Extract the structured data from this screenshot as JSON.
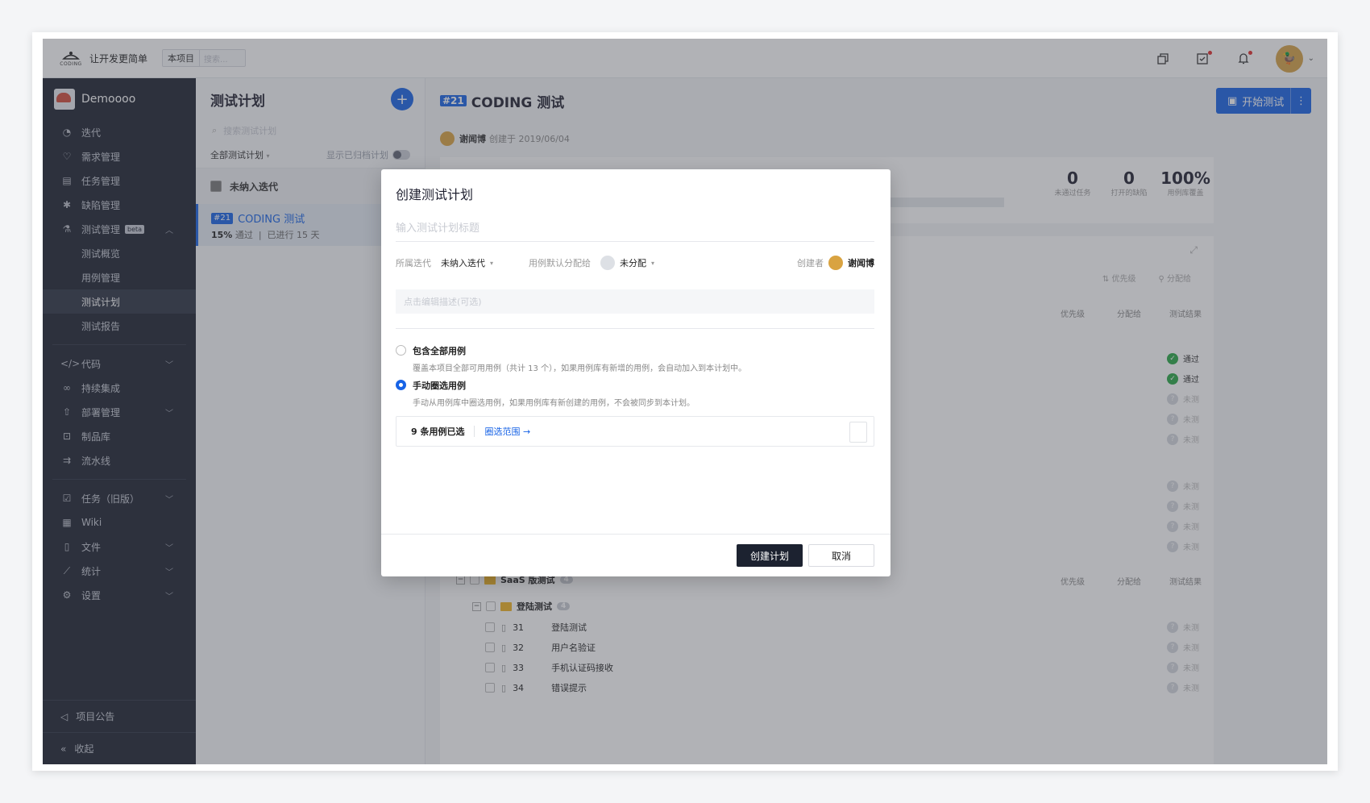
{
  "topbar": {
    "logo_text": "CODING",
    "slogan": "让开发更简单",
    "scope_tag": "本项目",
    "search_placeholder": "搜索..."
  },
  "sidebar": {
    "project_name": "Demoooo",
    "items": [
      {
        "label": "迭代",
        "icon": "iteration-icon"
      },
      {
        "label": "需求管理",
        "icon": "bulb-icon"
      },
      {
        "label": "任务管理",
        "icon": "task-icon"
      },
      {
        "label": "缺陷管理",
        "icon": "bug-icon"
      },
      {
        "label": "测试管理",
        "icon": "flask-icon",
        "badge": "beta"
      },
      {
        "label": "测试概览"
      },
      {
        "label": "用例管理"
      },
      {
        "label": "测试计划"
      },
      {
        "label": "测试报告"
      },
      {
        "label": "代码",
        "icon": "code-icon"
      },
      {
        "label": "持续集成",
        "icon": "infinity-icon"
      },
      {
        "label": "部署管理",
        "icon": "rocket-icon"
      },
      {
        "label": "制品库",
        "icon": "package-icon"
      },
      {
        "label": "流水线",
        "icon": "pipeline-icon"
      },
      {
        "label": "任务（旧版）",
        "icon": "checkbox-icon"
      },
      {
        "label": "Wiki",
        "icon": "doc-icon"
      },
      {
        "label": "文件",
        "icon": "file-icon"
      },
      {
        "label": "统计",
        "icon": "chart-icon"
      },
      {
        "label": "设置",
        "icon": "gear-icon"
      }
    ],
    "announcement": "项目公告",
    "collapse": "收起"
  },
  "plans": {
    "title": "测试计划",
    "search_placeholder": "搜索测试计划",
    "filter_label": "全部测试计划",
    "show_archived": "显示已归档计划",
    "group_label": "未纳入迭代",
    "item": {
      "id": "#21",
      "name": "CODING 测试",
      "pass_pct": "15%",
      "pass_label": "通过",
      "duration": "已进行 15 天"
    }
  },
  "main": {
    "id": "#21",
    "title": "CODING 测试",
    "start_button": "开始测试",
    "creator": "谢闻博",
    "created_text": "创建于 2019/06/04",
    "stats": [
      {
        "value": "0",
        "label": "未通过任务"
      },
      {
        "value": "0",
        "label": "打开的缺陷"
      },
      {
        "value": "100%",
        "label": "用例库覆盖"
      }
    ],
    "toolbar": {
      "priority": "优先级",
      "assignee": "分配给"
    },
    "columns": {
      "priority": "优先级",
      "assignee": "分配给",
      "result": "测试结果"
    },
    "results": [
      "通过",
      "通过",
      "未测",
      "未测",
      "未测",
      "未测",
      "未测",
      "未测",
      "未测"
    ],
    "folder": {
      "name": "SaaS 版测试",
      "count": "4"
    },
    "subfolder": {
      "name": "登陆测试",
      "count": "4"
    },
    "cases": [
      {
        "num": "31",
        "name": "登陆测试",
        "result": "未测"
      },
      {
        "num": "32",
        "name": "用户名验证",
        "result": "未测"
      },
      {
        "num": "33",
        "name": "手机认证码接收",
        "result": "未测"
      },
      {
        "num": "34",
        "name": "错误提示",
        "result": "未测"
      }
    ]
  },
  "modal": {
    "title": "创建测试计划",
    "title_placeholder": "输入测试计划标题",
    "iteration_label": "所属迭代",
    "iteration_value": "未纳入迭代",
    "assign_label": "用例默认分配给",
    "assign_value": "未分配",
    "creator_label": "创建者",
    "creator_value": "谢闻博",
    "desc_placeholder": "点击编辑描述(可选)",
    "option_all_title": "包含全部用例",
    "option_all_desc": "覆盖本项目全部可用用例（共计 13 个），如果用例库有新增的用例，会自动加入到本计划中。",
    "option_manual_title": "手动圈选用例",
    "option_manual_desc": "手动从用例库中圈选用例，如果用例库有新创建的用例，不会被同步到本计划。",
    "selected_count": "9 条用例已选",
    "select_range": "圈选范围 →",
    "create_button": "创建计划",
    "cancel_button": "取消"
  }
}
